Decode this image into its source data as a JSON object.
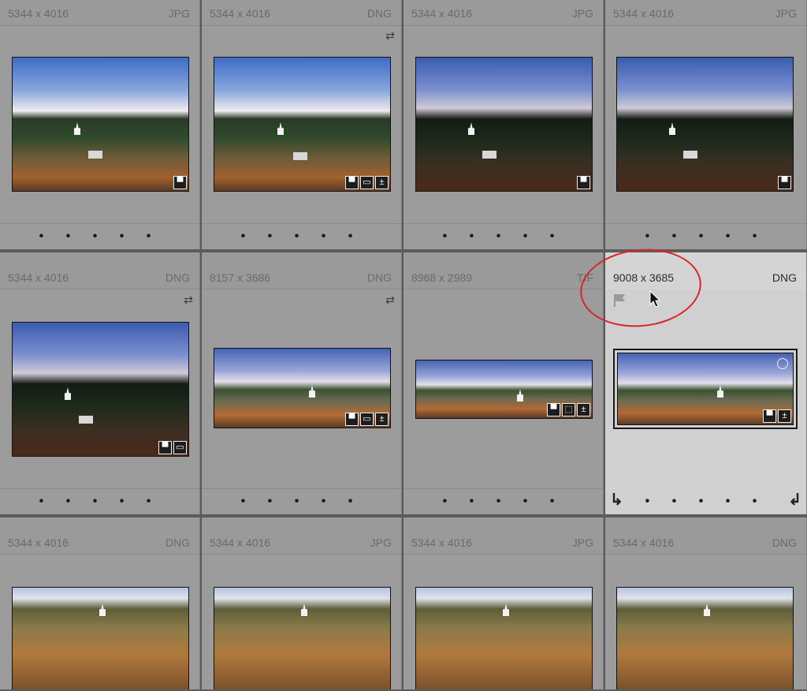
{
  "cells": [
    {
      "dims": "5344 x 4016",
      "format": "JPG",
      "rating": "• • • • •",
      "badges": [
        "▀"
      ]
    },
    {
      "dims": "5344 x 4016",
      "format": "DNG",
      "rating": "• • • • •",
      "badges": [
        "▀",
        "▭",
        "±"
      ]
    },
    {
      "dims": "5344 x 4016",
      "format": "JPG",
      "rating": "• • • • •",
      "badges": [
        "▀"
      ]
    },
    {
      "dims": "5344 x 4016",
      "format": "JPG",
      "rating": "• • • • •",
      "badges": [
        "▀"
      ]
    },
    {
      "dims": "5344 x 4016",
      "format": "DNG",
      "rating": "• • • • •",
      "badges": [
        "▀",
        "▭"
      ]
    },
    {
      "dims": "8157 x 3686",
      "format": "DNG",
      "rating": "• • • • •",
      "badges": [
        "▀",
        "▭",
        "±"
      ]
    },
    {
      "dims": "8968 x 2989",
      "format": "TIF",
      "rating": "• • • • •",
      "badges": [
        "▀",
        "⬚",
        "±"
      ]
    },
    {
      "dims": "9008 x 3685",
      "format": "DNG",
      "rating": "• • • • •",
      "badges": [
        "▀",
        "±"
      ],
      "selected": true
    },
    {
      "dims": "5344 x 4016",
      "format": "DNG",
      "rating": "",
      "badges": []
    },
    {
      "dims": "5344 x 4016",
      "format": "JPG",
      "rating": "",
      "badges": []
    },
    {
      "dims": "5344 x 4016",
      "format": "JPG",
      "rating": "",
      "badges": []
    },
    {
      "dims": "5344 x 4016",
      "format": "DNG",
      "rating": "",
      "badges": []
    }
  ],
  "icons": {
    "sync": "sync-icon",
    "flag": "flag-icon",
    "rotate_left": "rotate-left-icon",
    "rotate_right": "rotate-right-icon",
    "cursor": "mouse-cursor-icon"
  },
  "colors": {
    "annotation": "#d8262a",
    "selected_cell": "#d0d0d0",
    "cell": "#9c9c9c"
  }
}
